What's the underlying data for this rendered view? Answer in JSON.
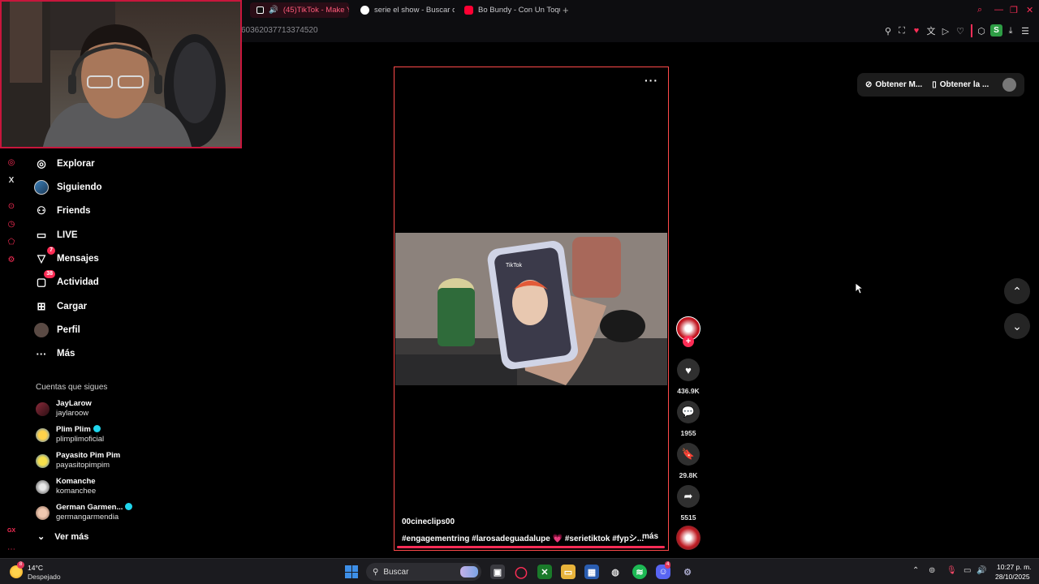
{
  "browser": {
    "tabs": [
      {
        "label": "(45)TikTok - Make Yo",
        "active": true
      },
      {
        "label": "serie el show - Buscar co",
        "active": false
      },
      {
        "label": "Bo Bundy - Con Un Toque",
        "active": false
      }
    ],
    "url": "60362037713374520",
    "accent_color": "#ff2e57",
    "profile_letter": "S"
  },
  "nav": {
    "items": [
      {
        "label": "Explorar",
        "icon": "compass-icon"
      },
      {
        "label": "Siguiendo",
        "icon": "following-avatar-icon"
      },
      {
        "label": "Friends",
        "icon": "friends-icon"
      },
      {
        "label": "LIVE",
        "icon": "live-icon"
      },
      {
        "label": "Mensajes",
        "icon": "messages-icon",
        "badge": "7"
      },
      {
        "label": "Actividad",
        "icon": "activity-icon",
        "badge": "38"
      },
      {
        "label": "Cargar",
        "icon": "upload-icon"
      },
      {
        "label": "Perfil",
        "icon": "profile-icon"
      },
      {
        "label": "Más",
        "icon": "more-icon"
      }
    ]
  },
  "following": {
    "title": "Cuentas que sigues",
    "accounts": [
      {
        "name": "JayLarow",
        "username": "jaylaroow",
        "verified": false
      },
      {
        "name": "Plim Plim",
        "username": "plimplimoficial",
        "verified": true
      },
      {
        "name": "Payasito Pim Pim",
        "username": "payasitopimpim",
        "verified": false
      },
      {
        "name": "Komanche",
        "username": "komanchee",
        "verified": false
      },
      {
        "name": "German Garmen...",
        "username": "germangarmendia",
        "verified": true
      }
    ],
    "see_more": "Ver más"
  },
  "video": {
    "author": "00cineclips00",
    "tags": "#engagementring #larosadeguadalupe 💗 #serietiktok #fypシ...",
    "more_label": "más",
    "likes": "436.9K",
    "comments": "1955",
    "saves": "29.8K",
    "shares": "5515",
    "phone_app_label": "TikTok"
  },
  "top_right": {
    "get_app_1": "Obtener M...",
    "get_app_2": "Obtener la ..."
  },
  "taskbar": {
    "weather_badge": "8",
    "temperature": "14°C",
    "weather": "Despejado",
    "search_label": "Buscar",
    "time": "10:27 p. m.",
    "date": "28/10/2025",
    "discord_badge": "4"
  }
}
